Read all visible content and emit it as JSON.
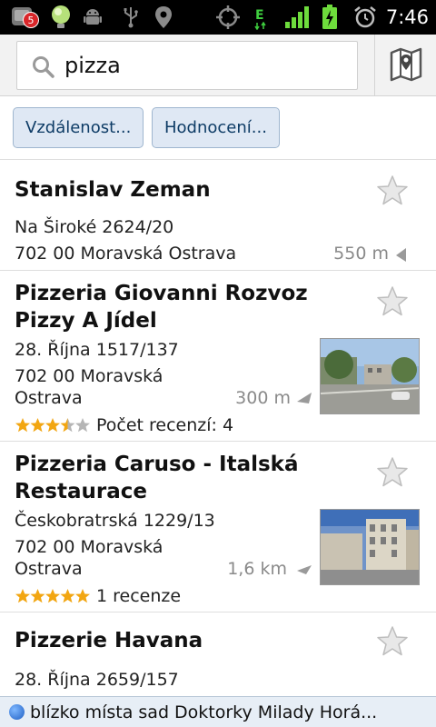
{
  "status_bar": {
    "notification_count": "5",
    "time": "7:46",
    "icons": [
      "app-notification-icon",
      "lightbulb-icon",
      "android-debug-icon",
      "usb-icon",
      "location-pin-icon",
      "gps-icon",
      "edge-data-icon",
      "signal-icon",
      "battery-charging-icon",
      "alarm-icon"
    ]
  },
  "search": {
    "query": "pizza",
    "map_button_icon": "map-icon"
  },
  "filters": [
    "Vzdálenost...",
    "Hodnocení..."
  ],
  "results": [
    {
      "title": "Stanislav Zeman",
      "address1": "Na Široké 2624/20",
      "address2": "702 00 Moravská Ostrava",
      "distance": "550 m"
    },
    {
      "title": "Pizzeria Giovanni Rozvoz Pizzy A Jídel",
      "address1": "28. Října 1517/137",
      "address2": "702 00 Moravská",
      "address3": "Ostrava",
      "distance": "300 m",
      "rating": 3.5,
      "reviews": "Počet recenzí: 4"
    },
    {
      "title": "Pizzeria Caruso - Italská Restaurace",
      "address1": "Českobratrská 1229/13",
      "address2": "702 00 Moravská",
      "address3": "Ostrava",
      "distance": "1,6 km",
      "rating": 5,
      "reviews": "1 recenze"
    },
    {
      "title": "Pizzerie Havana",
      "address1": "28. Října 2659/157"
    }
  ],
  "footer": {
    "location_text": "blízko místa sad Doktorky Milady Horá..."
  },
  "colors": {
    "chip_bg": "#dfe8f4",
    "chip_text": "#0e3c66",
    "star_rating": "#f2a612",
    "distance_text": "#8a8a8a"
  }
}
